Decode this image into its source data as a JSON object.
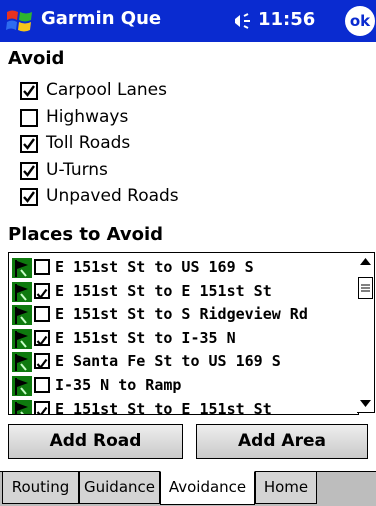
{
  "titlebar": {
    "app_title": "Garmin Que",
    "time": "11:56",
    "ok_label": "ok"
  },
  "avoid": {
    "heading": "Avoid",
    "options": [
      {
        "label": "Carpool Lanes",
        "checked": true
      },
      {
        "label": "Highways",
        "checked": false
      },
      {
        "label": "Toll Roads",
        "checked": true
      },
      {
        "label": "U-Turns",
        "checked": true
      },
      {
        "label": "Unpaved Roads",
        "checked": true
      }
    ]
  },
  "places": {
    "heading": "Places to Avoid",
    "items": [
      {
        "label": "E 151st St to US 169 S",
        "checked": false
      },
      {
        "label": "E 151st St to E 151st St",
        "checked": true
      },
      {
        "label": "E 151st St to S Ridgeview Rd",
        "checked": false
      },
      {
        "label": "E 151st St to I-35 N",
        "checked": true
      },
      {
        "label": "E Santa Fe St to US 169 S",
        "checked": true
      },
      {
        "label": "I-35 N to Ramp",
        "checked": false
      },
      {
        "label": "E 151st St to E 151st St",
        "checked": true
      }
    ]
  },
  "buttons": {
    "add_road": "Add Road",
    "add_area": "Add Area"
  },
  "tabs": [
    {
      "label": "Routing",
      "active": false
    },
    {
      "label": "Guidance",
      "active": false
    },
    {
      "label": "Avoidance",
      "active": true
    },
    {
      "label": "Home",
      "active": false
    }
  ],
  "colors": {
    "titlebar": "#0a2bd0",
    "flag": "#0e7a0e"
  }
}
